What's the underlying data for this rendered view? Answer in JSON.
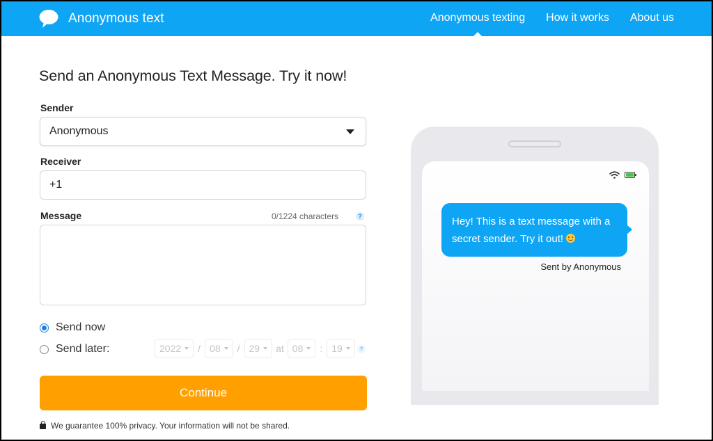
{
  "header": {
    "brand": "Anonymous text",
    "nav": [
      {
        "label": "Anonymous texting",
        "active": true
      },
      {
        "label": "How it works",
        "active": false
      },
      {
        "label": "About us",
        "active": false
      }
    ]
  },
  "form": {
    "title": "Send an Anonymous Text Message. Try it now!",
    "sender": {
      "label": "Sender",
      "value": "Anonymous"
    },
    "receiver": {
      "label": "Receiver",
      "value": "+1"
    },
    "message": {
      "label": "Message",
      "value": "",
      "counter": "0/1224 characters",
      "help": "?"
    },
    "send_now": {
      "label": "Send now",
      "checked": true
    },
    "send_later": {
      "label": "Send later:",
      "checked": false,
      "year": "2022",
      "month": "08",
      "day": "29",
      "at": "at",
      "hour": "08",
      "minute": "19",
      "date_sep": "/",
      "time_sep": ":",
      "help": "?"
    },
    "continue_label": "Continue",
    "privacy": "We guarantee 100% privacy. Your information will not be shared."
  },
  "preview": {
    "message": "Hey! This is a text message with a secret sender. Try it out!",
    "sent_by": "Sent by Anonymous"
  },
  "colors": {
    "primary": "#0ea5f5",
    "accent": "#ff9f00",
    "radio": "#1a7ee6",
    "battery": "#3ccb3c"
  },
  "icons": [
    "speech-bubble-icon",
    "caret-down-icon",
    "help-icon",
    "lock-icon",
    "wifi-icon",
    "battery-icon",
    "smile-emoji-icon"
  ]
}
